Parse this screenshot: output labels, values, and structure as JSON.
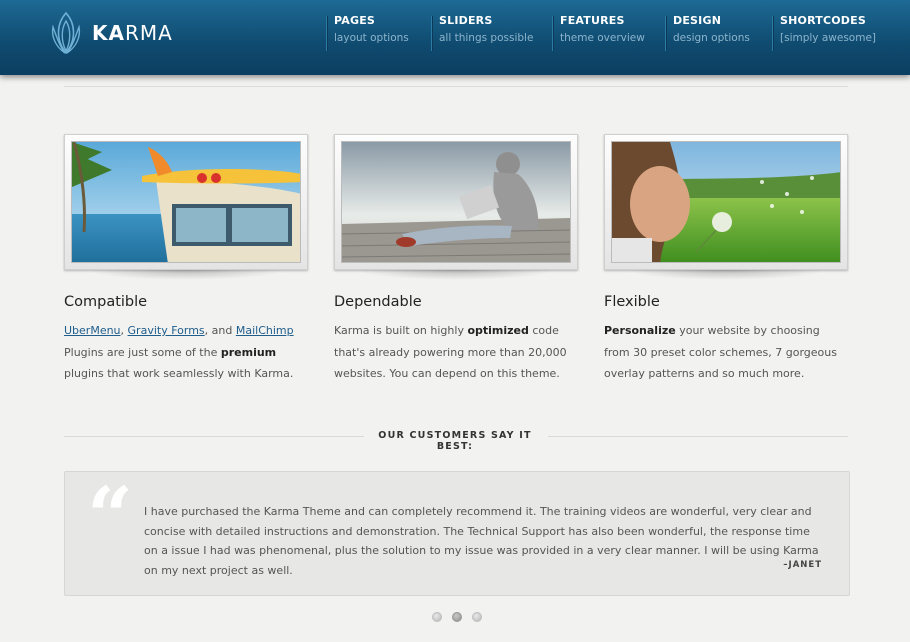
{
  "brand": {
    "name_bold": "KA",
    "name_rest": "RMA"
  },
  "nav": [
    {
      "title": "PAGES",
      "subtitle": "layout options"
    },
    {
      "title": "SLIDERS",
      "subtitle": "all things possible"
    },
    {
      "title": "FEATURES",
      "subtitle": "theme overview"
    },
    {
      "title": "DESIGN",
      "subtitle": "design options"
    },
    {
      "title": "SHORTCODES",
      "subtitle": "[simply awesome]"
    }
  ],
  "features": [
    {
      "title": "Compatible",
      "link1": "UberMenu",
      "sep1": ", ",
      "link2": "Gravity Forms",
      "sep2": ", and ",
      "link3": "MailChimp",
      "text_a": " Plugins are just some of the ",
      "bold": "premium",
      "text_b": " plugins that work seamlessly with Karma."
    },
    {
      "title": "Dependable",
      "text_a": "Karma is built on highly ",
      "bold": "optimized",
      "text_b": " code that's already powering more than 20,000 websites. You can depend on this theme."
    },
    {
      "title": "Flexible",
      "bold": "Personalize",
      "text_b": " your website by choosing from 30 preset color schemes, 7 gorgeous overlay patterns and so much more."
    }
  ],
  "customers": {
    "heading": "OUR CUSTOMERS SAY IT BEST:",
    "quote_mark": "“",
    "quote": "I have purchased the Karma Theme and can completely recommend it. The training videos are wonderful, very clear and concise with detailed instructions and demonstration. The Technical Support has also been wonderful, the response time on a issue I had was phenomenal, plus the solution to my issue was provided in a very clear manner. I will be using Karma on my next project as well.",
    "author": "–JANET"
  },
  "slider": {
    "dot_count": 3,
    "active_index": 1
  }
}
